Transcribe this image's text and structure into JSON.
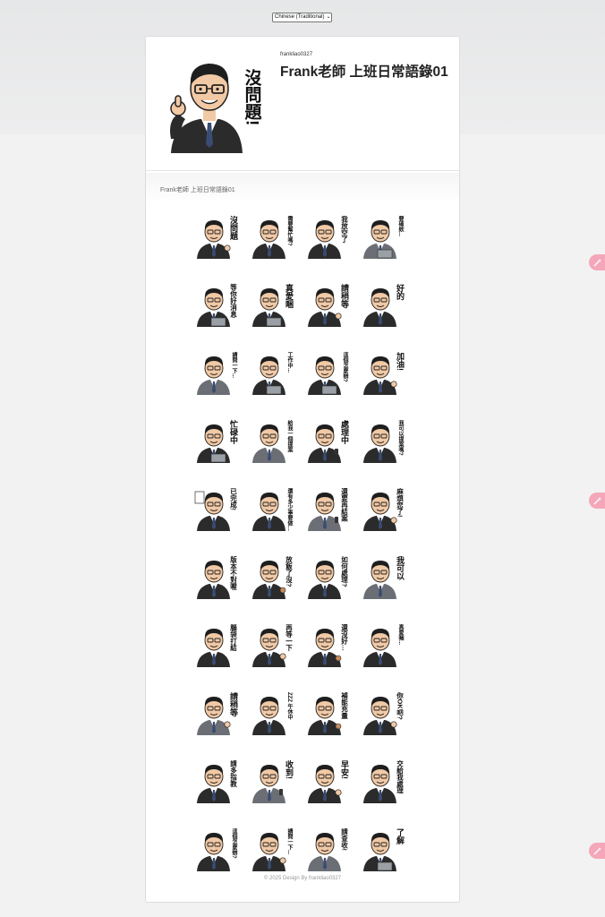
{
  "language_select": {
    "value": "Chinese (Traditional)"
  },
  "header": {
    "author": "frankliao0327",
    "title": "Frank老師 上班日常語錄01",
    "main_sticker_text": "沒問題!"
  },
  "section": {
    "title": "Frank老師 上班日常語錄01"
  },
  "stickers": [
    {
      "text": "沒問題",
      "pose": "thumb"
    },
    {
      "text": "需要幫忙嗎?",
      "pose": "point"
    },
    {
      "text": "我放空了",
      "pose": "chair"
    },
    {
      "text": "要確欸...",
      "pose": "laptop"
    },
    {
      "text": "等你好消息",
      "pose": "laptop"
    },
    {
      "text": "真愛睏",
      "pose": "laptop"
    },
    {
      "text": "請稍等",
      "pose": "hand"
    },
    {
      "text": "好的",
      "pose": "cross"
    },
    {
      "text": "請問一下...",
      "pose": "think"
    },
    {
      "text": "工作中...",
      "pose": "desk"
    },
    {
      "text": "這個怎麼辦?",
      "pose": "desk"
    },
    {
      "text": "加油!",
      "pose": "cheer"
    },
    {
      "text": "忙碌中",
      "pose": "laptop"
    },
    {
      "text": "給我一個提案",
      "pose": "point"
    },
    {
      "text": "處理中",
      "pose": "phone"
    },
    {
      "text": "我可以提案嗎?",
      "pose": "point"
    },
    {
      "text": "已完成!",
      "pose": "paper"
    },
    {
      "text": "還有多少事要做…",
      "pose": "think"
    },
    {
      "text": "還要再結案",
      "pose": "phone"
    },
    {
      "text": "麻煩您了!",
      "pose": "hand"
    },
    {
      "text": "版本不對喔",
      "pose": "point"
    },
    {
      "text": "放飯了沒?",
      "pose": "clock"
    },
    {
      "text": "如何處理?",
      "pose": "think"
    },
    {
      "text": "我可以",
      "pose": "cross"
    },
    {
      "text": "腦袋打結",
      "pose": "think"
    },
    {
      "text": "再等一下",
      "pose": "hand"
    },
    {
      "text": "還沒好…",
      "pose": "cup"
    },
    {
      "text": "真愛睏...",
      "pose": "sleep"
    },
    {
      "text": "請稍等",
      "pose": "hand"
    },
    {
      "text": "ZZZ 午休中",
      "pose": "sleep"
    },
    {
      "text": "補能充量",
      "pose": "cup"
    },
    {
      "text": "你OK吧?",
      "pose": "thumb"
    },
    {
      "text": "請多指教",
      "pose": "point"
    },
    {
      "text": "收到!",
      "pose": "phone"
    },
    {
      "text": "早安!",
      "pose": "hand"
    },
    {
      "text": "交給我處理",
      "pose": "point"
    },
    {
      "text": "這個怎麼辦?",
      "pose": "think"
    },
    {
      "text": "請問一下...",
      "pose": "hand"
    },
    {
      "text": "請查收!",
      "pose": "cross"
    },
    {
      "text": "了解",
      "pose": "laptop"
    }
  ],
  "footer": {
    "text": "© 2025 Design By frankliao0327"
  },
  "colors": {
    "accent_pink": "#f4a7b9",
    "suit": "#2b2b2b",
    "tie": "#3a4c73",
    "skin": "#f1c9a5"
  }
}
